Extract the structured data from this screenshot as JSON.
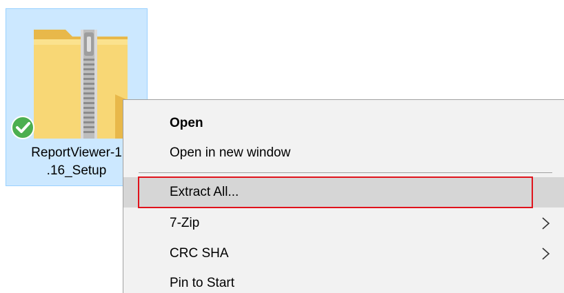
{
  "file": {
    "name_line1": "ReportViewer-1",
    "name_line2": ".16_Setup",
    "icon": "zip-folder-icon",
    "status_icon": "sync-check-icon"
  },
  "context_menu": {
    "items": [
      {
        "label": "Open",
        "bold": true
      },
      {
        "label": "Open in new window"
      },
      {
        "label": "Extract All...",
        "highlighted": true
      },
      {
        "label": "7-Zip",
        "has_submenu": true
      },
      {
        "label": "CRC SHA",
        "has_submenu": true
      },
      {
        "label": "Pin to Start"
      }
    ]
  },
  "colors": {
    "selection": "#cce8ff",
    "menu_background": "#f2f2f2",
    "hover": "#d6d6d6",
    "highlight_border": "#e0121b",
    "check_green": "#4caf50"
  }
}
